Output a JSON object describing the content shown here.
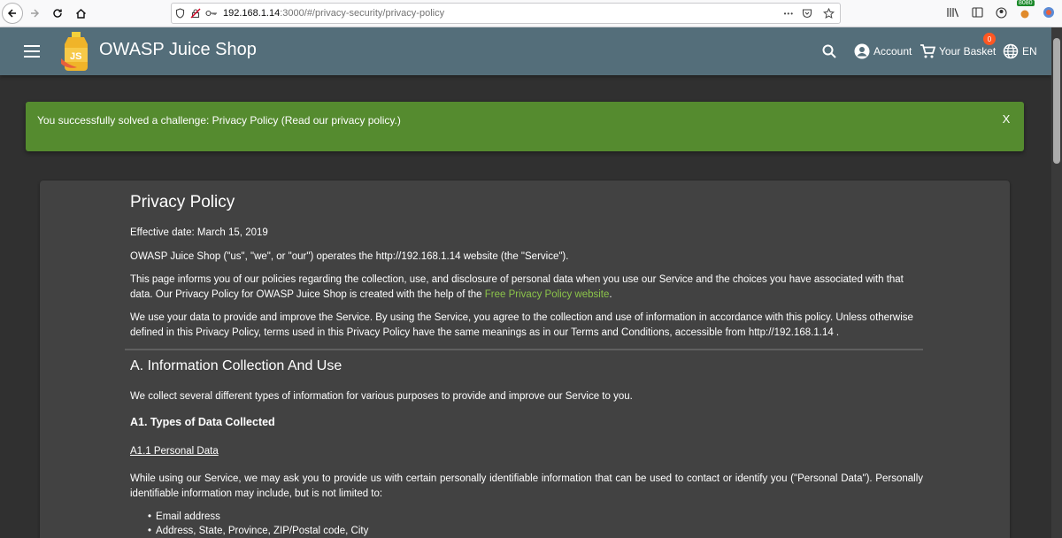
{
  "browser": {
    "url_host": "192.168.1.14",
    "url_path": ":3000/#/privacy-security/privacy-policy",
    "url_more": "•••",
    "extension_badge": "8080"
  },
  "header": {
    "title": "OWASP Juice Shop",
    "account_label": "Account",
    "basket_label": "Your Basket",
    "basket_count": "0",
    "language_label": "EN"
  },
  "snackbar": {
    "message": "You successfully solved a challenge: Privacy Policy (Read our privacy policy.)",
    "close_label": "X"
  },
  "policy": {
    "title": "Privacy Policy",
    "effective_date": "Effective date: March 15, 2019",
    "intro": "OWASP Juice Shop (\"us\", \"we\", or \"our\") operates the http://192.168.1.14 website (the \"Service\").",
    "informs_text": "This page informs you of our policies regarding the collection, use, and disclosure of personal data when you use our Service and the choices you have associated with that data. Our Privacy Policy for OWASP Juice Shop is created with the help of the ",
    "informs_link": "Free Privacy Policy website",
    "informs_end": ".",
    "use_data": "We use your data to provide and improve the Service. By using the Service, you agree to the collection and use of information in accordance with this policy. Unless otherwise defined in this Privacy Policy, terms used in this Privacy Policy have the same meanings as in our Terms and Conditions, accessible from http://192.168.1.14 .",
    "section_a_title": "A. Information Collection And Use",
    "section_a_text": "We collect several different types of information for various purposes to provide and improve our Service to you.",
    "a1_title": "A1. Types of Data Collected",
    "a11_title": "A1.1 Personal Data",
    "personal_text": "While using our Service, we may ask you to provide us with certain personally identifiable information that can be used to contact or identify you (\"Personal Data\"). Personally identifiable information may include, but is not limited to:",
    "list": [
      "Email address",
      "Address, State, Province, ZIP/Postal code, City"
    ]
  }
}
